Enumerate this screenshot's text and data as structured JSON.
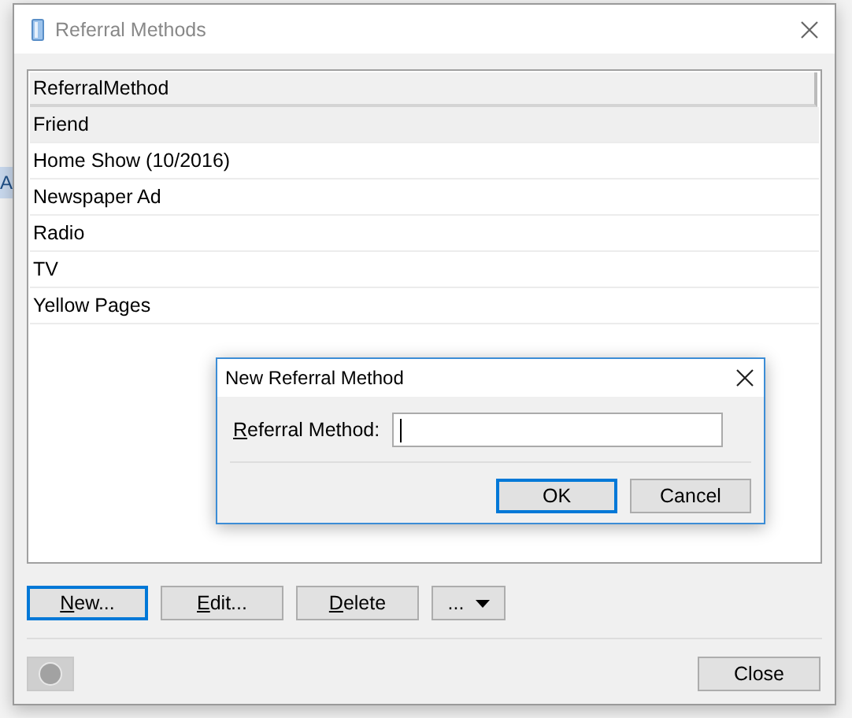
{
  "background": {
    "side_tab_text": "A"
  },
  "window": {
    "title": "Referral Methods"
  },
  "table": {
    "columns": [
      "ReferralMethod"
    ],
    "rows": [
      {
        "cells": [
          "Friend"
        ],
        "selected": true
      },
      {
        "cells": [
          "Home Show (10/2016)"
        ],
        "selected": false
      },
      {
        "cells": [
          "Newspaper Ad"
        ],
        "selected": false
      },
      {
        "cells": [
          "Radio"
        ],
        "selected": false
      },
      {
        "cells": [
          "TV"
        ],
        "selected": false
      },
      {
        "cells": [
          "Yellow Pages"
        ],
        "selected": false
      }
    ]
  },
  "buttons": [
    {
      "kind": "text",
      "label": "New...",
      "mnemonic_underlined": true,
      "focused": true
    },
    {
      "kind": "text",
      "label": "Edit...",
      "mnemonic_underlined": true,
      "focused": false
    },
    {
      "kind": "text",
      "label": "Delete",
      "mnemonic_underlined": true,
      "focused": false
    },
    {
      "kind": "dropdown",
      "label": "...",
      "focused": false
    }
  ],
  "footer": {
    "close_button": "Close"
  },
  "modal": {
    "title": "New Referral Method",
    "field_label": "Referral Method:",
    "field_mnemonic_underlined": true,
    "field_focused": true,
    "buttons": [
      {
        "label": "OK",
        "default": true
      },
      {
        "label": "Cancel",
        "default": false
      }
    ]
  }
}
